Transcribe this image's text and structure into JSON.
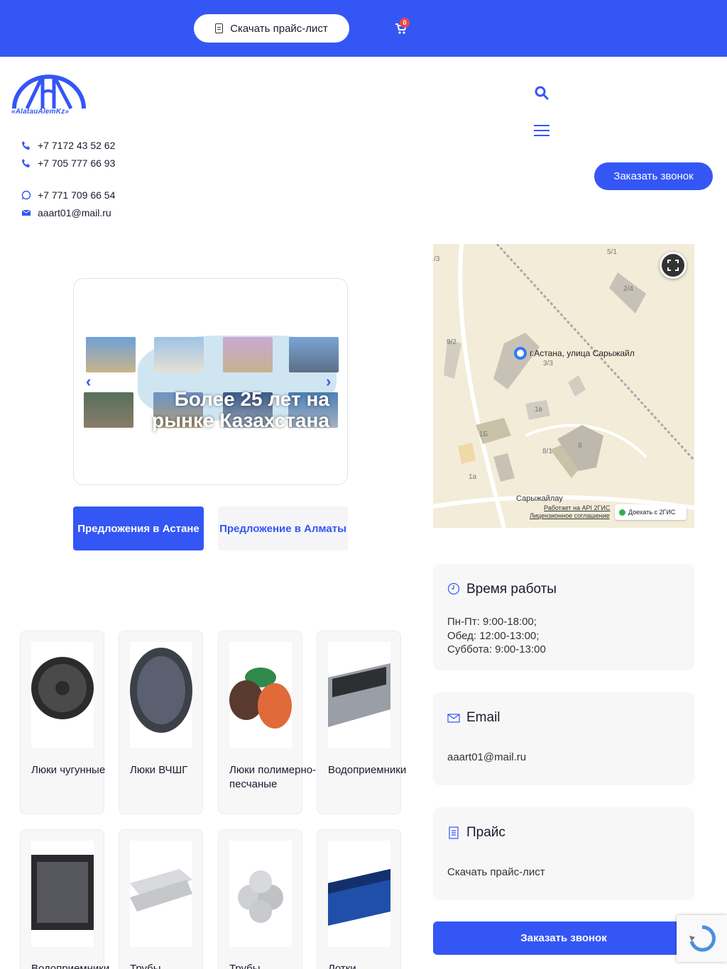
{
  "topbar": {
    "price_label": "Скачать прайс-лист",
    "cart_count": "0"
  },
  "logo": {
    "text": "«AlatauAlemKz»"
  },
  "contacts": [
    {
      "icon": "phone-icon",
      "text": "+7 7172 43 52 62"
    },
    {
      "icon": "phone-icon",
      "text": "+7 705 777 66 93"
    },
    {
      "icon": "whatsapp-icon",
      "text": "+7 771 709 66 54"
    },
    {
      "icon": "mail-icon",
      "text": "aaart01@mail.ru"
    }
  ],
  "header": {
    "call_label": "Заказать звонок"
  },
  "slider": {
    "caption": "Более 25 лет на рынке Казахстана"
  },
  "offers": {
    "astana": "Предложения в Астане",
    "almaty": "Предложение в Алматы"
  },
  "map": {
    "address": "г.Астана, улица Сарыжайл",
    "street": "Сарыжайлау",
    "api_note": "Работает на API 2ГИС",
    "license": "Лицензионное соглашение",
    "route": "Доехать с 2ГИС",
    "labels": [
      "5/1",
      "2/4",
      "9/2",
      "3/3",
      "1в",
      "1Б",
      "8/1",
      "8",
      "1а",
      "/3"
    ]
  },
  "hours": {
    "title": "Время работы",
    "lines": [
      "Пн-Пт: 9:00-18:00;",
      "Обед: 12:00-13:00;",
      "Суббота: 9:00-13:00"
    ]
  },
  "email": {
    "title": "Email",
    "value": "aaart01@mail.ru"
  },
  "price": {
    "title": "Прайс",
    "link": "Скачать прайс-лист"
  },
  "footer_call": "Заказать звонок",
  "products": [
    {
      "label": "Люки чугунные"
    },
    {
      "label": "Люки ВЧШГ"
    },
    {
      "label": "Люки полимерно-песчаные"
    },
    {
      "label": "Водоприемники"
    },
    {
      "label": "Водоприемники"
    },
    {
      "label": "Трубы"
    },
    {
      "label": "Трубы"
    },
    {
      "label": "Лотки"
    }
  ],
  "colors": {
    "accent": "#3456f5",
    "card_bg": "#f7f7f8",
    "badge": "#e5484d"
  }
}
